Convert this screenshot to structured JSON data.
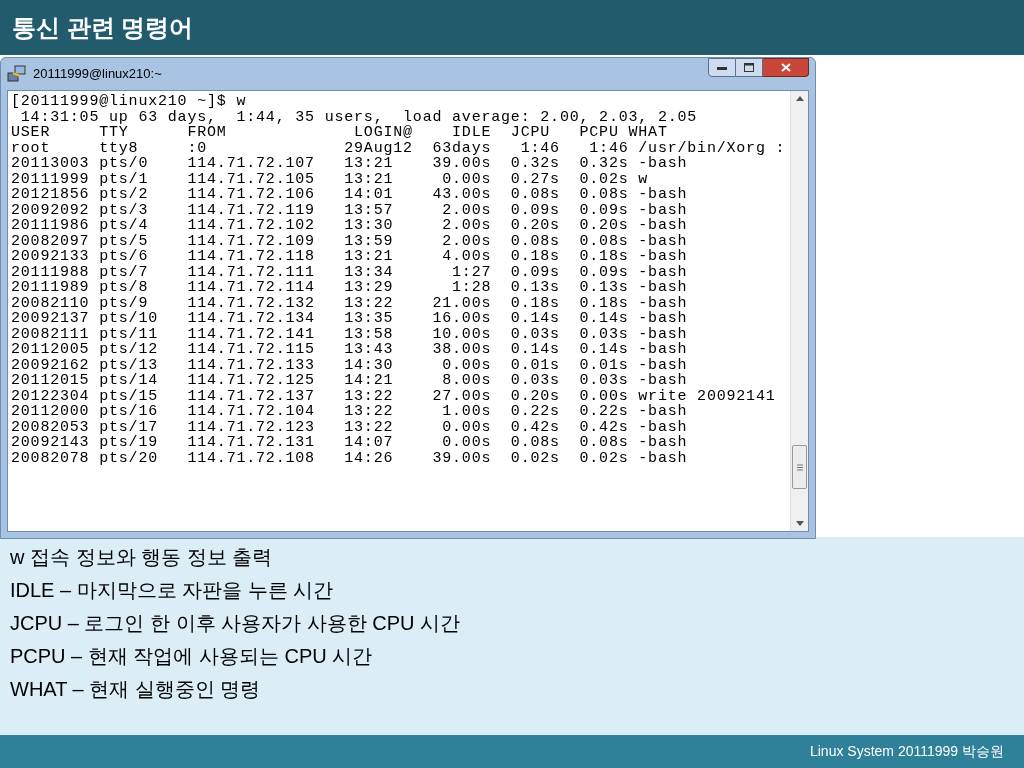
{
  "slide": {
    "title": "통신 관련 명령어",
    "footer": "Linux System 20111999 박승원"
  },
  "terminal": {
    "title": "20111999@linux210:~",
    "prompt": "[20111999@linux210 ~]$ w",
    "uptime": " 14:31:05 up 63 days,  1:44, 35 users,  load average: 2.00, 2.03, 2.05",
    "columns": [
      "USER",
      "TTY",
      "FROM",
      "LOGIN@",
      "IDLE",
      "JCPU",
      "PCPU",
      "WHAT"
    ],
    "rows": [
      {
        "user": "root",
        "tty": "tty8",
        "from": ":0",
        "login": "29Aug12",
        "idle": "63days",
        "jcpu": "1:46",
        "pcpu": "1:46",
        "what": "/usr/bin/Xorg :"
      },
      {
        "user": "20113003",
        "tty": "pts/0",
        "from": "114.71.72.107",
        "login": "13:21",
        "idle": "39.00s",
        "jcpu": "0.32s",
        "pcpu": "0.32s",
        "what": "-bash"
      },
      {
        "user": "20111999",
        "tty": "pts/1",
        "from": "114.71.72.105",
        "login": "13:21",
        "idle": "0.00s",
        "jcpu": "0.27s",
        "pcpu": "0.02s",
        "what": "w"
      },
      {
        "user": "20121856",
        "tty": "pts/2",
        "from": "114.71.72.106",
        "login": "14:01",
        "idle": "43.00s",
        "jcpu": "0.08s",
        "pcpu": "0.08s",
        "what": "-bash"
      },
      {
        "user": "20092092",
        "tty": "pts/3",
        "from": "114.71.72.119",
        "login": "13:57",
        "idle": "2.00s",
        "jcpu": "0.09s",
        "pcpu": "0.09s",
        "what": "-bash"
      },
      {
        "user": "20111986",
        "tty": "pts/4",
        "from": "114.71.72.102",
        "login": "13:30",
        "idle": "2.00s",
        "jcpu": "0.20s",
        "pcpu": "0.20s",
        "what": "-bash"
      },
      {
        "user": "20082097",
        "tty": "pts/5",
        "from": "114.71.72.109",
        "login": "13:59",
        "idle": "2.00s",
        "jcpu": "0.08s",
        "pcpu": "0.08s",
        "what": "-bash"
      },
      {
        "user": "20092133",
        "tty": "pts/6",
        "from": "114.71.72.118",
        "login": "13:21",
        "idle": "4.00s",
        "jcpu": "0.18s",
        "pcpu": "0.18s",
        "what": "-bash"
      },
      {
        "user": "20111988",
        "tty": "pts/7",
        "from": "114.71.72.111",
        "login": "13:34",
        "idle": "1:27",
        "jcpu": "0.09s",
        "pcpu": "0.09s",
        "what": "-bash"
      },
      {
        "user": "20111989",
        "tty": "pts/8",
        "from": "114.71.72.114",
        "login": "13:29",
        "idle": "1:28",
        "jcpu": "0.13s",
        "pcpu": "0.13s",
        "what": "-bash"
      },
      {
        "user": "20082110",
        "tty": "pts/9",
        "from": "114.71.72.132",
        "login": "13:22",
        "idle": "21.00s",
        "jcpu": "0.18s",
        "pcpu": "0.18s",
        "what": "-bash"
      },
      {
        "user": "20092137",
        "tty": "pts/10",
        "from": "114.71.72.134",
        "login": "13:35",
        "idle": "16.00s",
        "jcpu": "0.14s",
        "pcpu": "0.14s",
        "what": "-bash"
      },
      {
        "user": "20082111",
        "tty": "pts/11",
        "from": "114.71.72.141",
        "login": "13:58",
        "idle": "10.00s",
        "jcpu": "0.03s",
        "pcpu": "0.03s",
        "what": "-bash"
      },
      {
        "user": "20112005",
        "tty": "pts/12",
        "from": "114.71.72.115",
        "login": "13:43",
        "idle": "38.00s",
        "jcpu": "0.14s",
        "pcpu": "0.14s",
        "what": "-bash"
      },
      {
        "user": "20092162",
        "tty": "pts/13",
        "from": "114.71.72.133",
        "login": "14:30",
        "idle": "0.00s",
        "jcpu": "0.01s",
        "pcpu": "0.01s",
        "what": "-bash"
      },
      {
        "user": "20112015",
        "tty": "pts/14",
        "from": "114.71.72.125",
        "login": "14:21",
        "idle": "8.00s",
        "jcpu": "0.03s",
        "pcpu": "0.03s",
        "what": "-bash"
      },
      {
        "user": "20122304",
        "tty": "pts/15",
        "from": "114.71.72.137",
        "login": "13:22",
        "idle": "27.00s",
        "jcpu": "0.20s",
        "pcpu": "0.00s",
        "what": "write 20092141"
      },
      {
        "user": "20112000",
        "tty": "pts/16",
        "from": "114.71.72.104",
        "login": "13:22",
        "idle": "1.00s",
        "jcpu": "0.22s",
        "pcpu": "0.22s",
        "what": "-bash"
      },
      {
        "user": "20082053",
        "tty": "pts/17",
        "from": "114.71.72.123",
        "login": "13:22",
        "idle": "0.00s",
        "jcpu": "0.42s",
        "pcpu": "0.42s",
        "what": "-bash"
      },
      {
        "user": "20092143",
        "tty": "pts/19",
        "from": "114.71.72.131",
        "login": "14:07",
        "idle": "0.00s",
        "jcpu": "0.08s",
        "pcpu": "0.08s",
        "what": "-bash"
      },
      {
        "user": "20082078",
        "tty": "pts/20",
        "from": "114.71.72.108",
        "login": "14:26",
        "idle": "39.00s",
        "jcpu": "0.02s",
        "pcpu": "0.02s",
        "what": "-bash"
      }
    ]
  },
  "notes": [
    "w 접속 정보와 행동 정보 출력",
    "IDLE – 마지막으로 자판을 누른 시간",
    "JCPU – 로그인 한 이후 사용자가 사용한 CPU 시간",
    "PCPU – 현재 작업에 사용되는 CPU 시간",
    "WHAT – 현재 실행중인 명령"
  ]
}
